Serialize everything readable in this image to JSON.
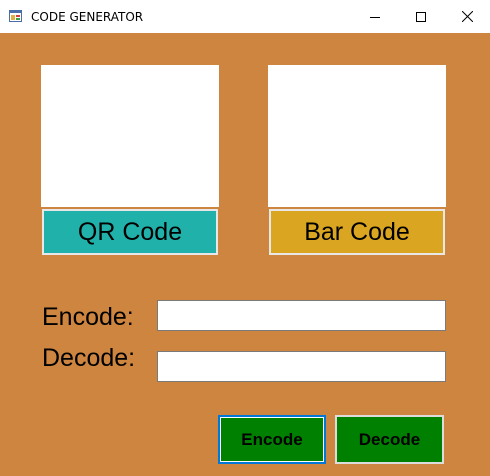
{
  "window": {
    "title": "CODE GENERATOR",
    "icons": {
      "app": "app-icon",
      "minimize": "minimize-icon",
      "maximize": "maximize-icon",
      "close": "close-icon"
    }
  },
  "buttons": {
    "qr": {
      "label": "QR Code",
      "color": "#20b2aa"
    },
    "bar": {
      "label": "Bar Code",
      "color": "#daa520"
    },
    "encode": {
      "label": "Encode",
      "color": "#008000"
    },
    "decode": {
      "label": "Decode",
      "color": "#008000"
    }
  },
  "fields": {
    "encode": {
      "label": "Encode:",
      "value": "",
      "placeholder": ""
    },
    "decode": {
      "label": "Decode:",
      "value": "",
      "placeholder": ""
    }
  },
  "colors": {
    "background": "#cd853f",
    "picture_box": "#ffffff"
  }
}
